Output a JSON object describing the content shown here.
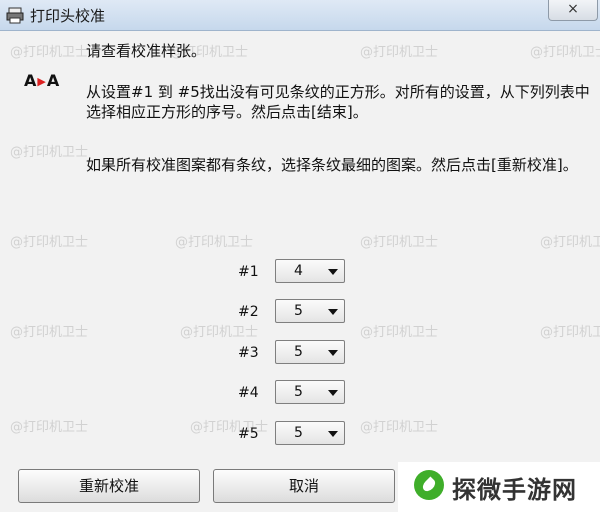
{
  "window": {
    "title": "打印头校准",
    "close_icon": "×"
  },
  "content": {
    "intro": "请查看校准样张。",
    "aa_icon_text": "A",
    "aa_icon_text2": "A",
    "para1": "从设置#1 到 #5找出没有可见条纹的正方形。对所有的设置，从下列列表中选择相应正方形的序号。然后点击[结束]。",
    "para2": "如果所有校准图案都有条纹，选择条纹最细的图案。然后点击[重新校准]。"
  },
  "settings": [
    {
      "label": "#1",
      "value": "4"
    },
    {
      "label": "#2",
      "value": "5"
    },
    {
      "label": "#3",
      "value": "5"
    },
    {
      "label": "#4",
      "value": "5"
    },
    {
      "label": "#5",
      "value": "5"
    }
  ],
  "buttons": {
    "recalibrate": "重新校准",
    "cancel": "取消"
  },
  "watermark_text": "@打印机卫士",
  "badge": {
    "text": "探微手游网",
    "color": "#3fae2a"
  }
}
